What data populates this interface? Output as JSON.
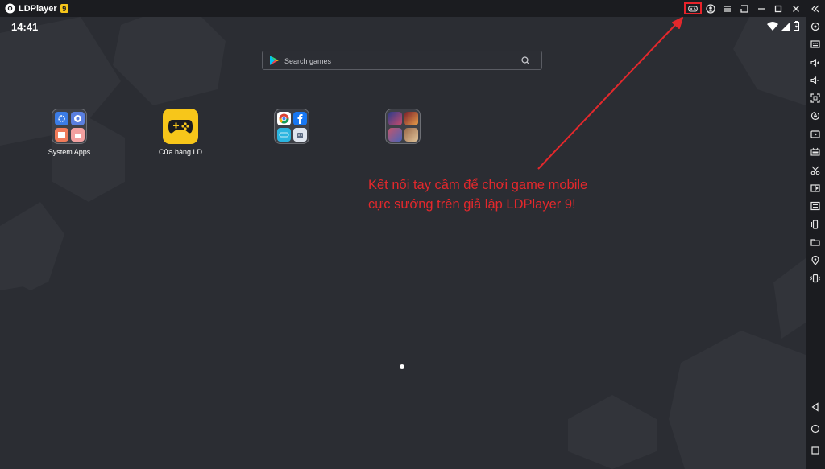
{
  "titlebar": {
    "app_name": "LDPlayer",
    "version_badge": "9",
    "icons": [
      "gamepad-icon",
      "account-icon",
      "menu-icon",
      "popout-icon",
      "minimize-icon",
      "maximize-icon",
      "close-icon"
    ]
  },
  "sidebar": {
    "collapse_icon": "chevrons-left-icon",
    "icons": [
      "settings-icon",
      "keyboard-icon",
      "volume-up-icon",
      "volume-down-icon",
      "screenshot-icon",
      "sync-icon",
      "video-icon",
      "apk-icon",
      "scissors-icon",
      "media-icon",
      "list-icon",
      "shake-icon",
      "folder-icon",
      "location-icon",
      "vibrate-icon"
    ],
    "nav": [
      "back-icon",
      "home-icon",
      "recents-icon"
    ]
  },
  "android": {
    "time": "14:41",
    "search": {
      "placeholder": "Search games"
    },
    "apps": [
      {
        "label": "System Apps",
        "type": "folder"
      },
      {
        "label": "Cửa hàng LD",
        "type": "app"
      },
      {
        "label": "",
        "type": "folder"
      },
      {
        "label": "",
        "type": "folder"
      }
    ]
  },
  "annotation": {
    "line1": "Kết nối tay cầm để chơi game mobile",
    "line2": "cực sướng trên giả lập LDPlayer 9!",
    "color": "#e3282c"
  },
  "colors": {
    "titlebar": "#1b1c20",
    "screen": "#2b2d33",
    "accent": "#f7c61a",
    "highlight": "#e8232a"
  }
}
